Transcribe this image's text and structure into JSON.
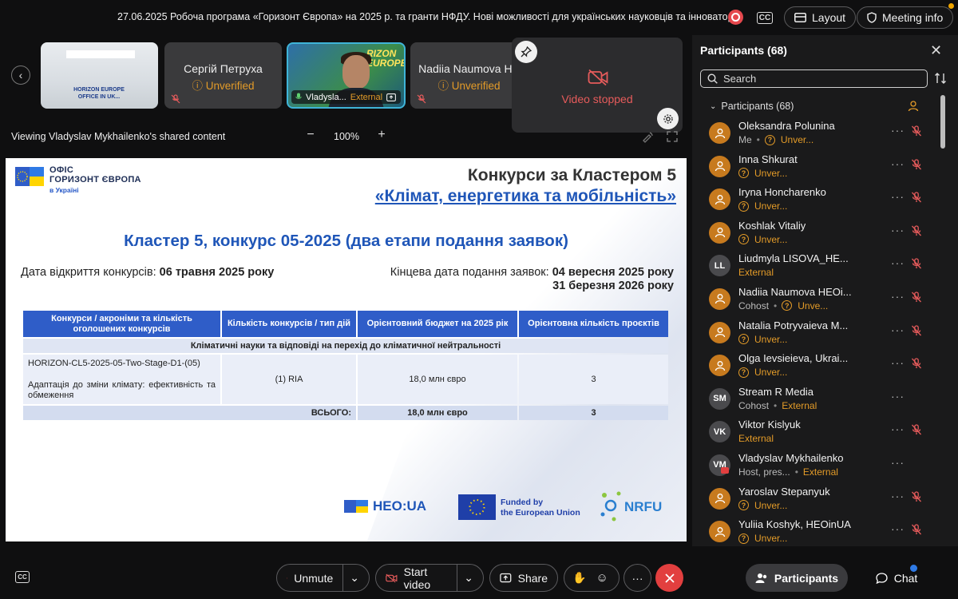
{
  "header": {
    "meeting_title": "27.06.2025 Робоча програма «Горизонт Європа» на 2025 р. та гранти НФДУ. Нові можливості для українських науковців та інноваторів",
    "layout_label": "Layout",
    "meeting_info_label": "Meeting info"
  },
  "filmstrip": {
    "tiles": [
      {
        "image_text": "HORIZON EUROPE OFFICE IN UK..."
      },
      {
        "name": "Сергій Петруха",
        "status": "Unverified"
      },
      {
        "name": "Vladysla...",
        "status": "External"
      },
      {
        "name": "Nadiia Naumova HE",
        "status": "Unverified"
      }
    ],
    "video_stopped_label": "Video stopped",
    "video_overlay_text": "RIZON EUROPE"
  },
  "share_bar": {
    "viewing_label": "Viewing Vladyslav Mykhailenko's shared content",
    "zoom_minus": "−",
    "zoom_value": "100%",
    "zoom_plus": "+"
  },
  "slide": {
    "office_line1": "ОФІС",
    "office_line2": "ГОРИЗОНТ ЄВРОПА",
    "office_line3": "в Україні",
    "title_line1": "Конкурси за Кластером 5",
    "title_line2": "«Клімат, енергетика та мобільність»",
    "subtitle": "Кластер 5, конкурс 05-2025 (два етапи подання заявок)",
    "open_date_label": "Дата відкриття конкурсів: ",
    "open_date_value": "06 травня 2025 року",
    "deadline_label": "Кінцева дата подання заявок: ",
    "deadline_value1": "04 вересня 2025 року",
    "deadline_value2": "31 березня 2026 року",
    "table": {
      "headers": [
        "Конкурси / акроніми та кількість оголошених конкурсів",
        "Кількість конкурсів / тип дій",
        "Орієнтовний бюджет на 2025 рік",
        "Орієнтовна кількість проєктів"
      ],
      "section": "Кліматичні науки та відповіді на перехід до кліматичної нейтральності",
      "row": {
        "call_id": "HORIZON-CL5-2025-05-Two-Stage-D1-(05)",
        "topic": "Адаптація до зміни клімату: ефективність та обмеження",
        "type": "(1) RIA",
        "budget": "18,0 млн євро",
        "projects": "3"
      },
      "total": {
        "label": "ВСЬОГО:",
        "budget": "18,0 млн євро",
        "projects": "3"
      }
    },
    "footer": {
      "heo": "HEO:UA",
      "funded_line1": "Funded by",
      "funded_line2": "the European Union",
      "nrfu": "NRFU"
    }
  },
  "toolbar": {
    "unmute_label": "Unmute",
    "start_video_label": "Start video",
    "share_label": "Share",
    "participants_label": "Participants",
    "chat_label": "Chat"
  },
  "panel": {
    "title": "Participants (68)",
    "search_placeholder": "Search",
    "group_label": "Participants (68)",
    "participants": [
      {
        "name": "Oleksandra Polunina",
        "role": "Me",
        "status": "Unver...",
        "initials": "",
        "muted": true
      },
      {
        "name": "Inna Shkurat",
        "role": "",
        "status": "Unver...",
        "initials": "",
        "muted": true
      },
      {
        "name": "Iryna Honcharenko",
        "role": "",
        "status": "Unver...",
        "initials": "",
        "muted": true
      },
      {
        "name": "Koshlak Vitaliy",
        "role": "",
        "status": "Unver...",
        "initials": "",
        "muted": true
      },
      {
        "name": "Liudmyla LISOVA_HE...",
        "role": "",
        "status": "External",
        "initials": "LL",
        "muted": true
      },
      {
        "name": "Nadiia Naumova HEOi...",
        "role": "Cohost",
        "status": "Unve...",
        "initials": "",
        "muted": true
      },
      {
        "name": "Natalia Potryvaieva M...",
        "role": "",
        "status": "Unver...",
        "initials": "",
        "muted": true
      },
      {
        "name": "Olga Ievsieieva, Ukrai...",
        "role": "",
        "status": "Unver...",
        "initials": "",
        "muted": true
      },
      {
        "name": "Stream R Media",
        "role": "Cohost",
        "status": "External",
        "initials": "SM",
        "muted": false
      },
      {
        "name": "Viktor Kislyuk",
        "role": "",
        "status": "External",
        "initials": "VK",
        "muted": true
      },
      {
        "name": "Vladyslav Mykhailenko",
        "role": "Host, pres...",
        "status": "External",
        "initials": "VM",
        "muted": false
      },
      {
        "name": "Yaroslav Stepanyuk",
        "role": "",
        "status": "Unver...",
        "initials": "",
        "muted": true
      },
      {
        "name": "Yuliia Koshyk, HEOinUA",
        "role": "",
        "status": "Unver...",
        "initials": "",
        "muted": true
      }
    ]
  },
  "colors": {
    "accent_orange": "#e39b28",
    "danger_red": "#e23f3f",
    "slide_blue": "#1f56b8",
    "table_header": "#2f5dc8"
  }
}
